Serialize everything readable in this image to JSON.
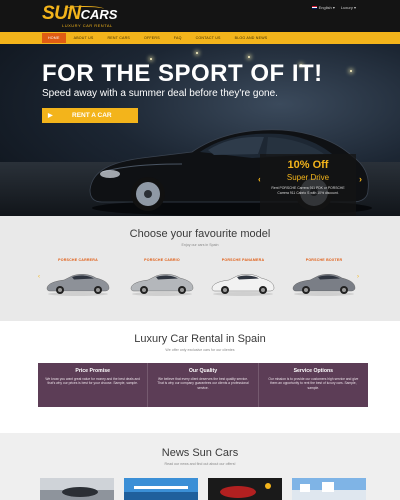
{
  "header": {
    "logo_main": "SUN",
    "logo_cars": "CARS",
    "logo_tagline": "LUXURY CAR RENTAL",
    "language": "English",
    "account": "Luxury"
  },
  "nav": {
    "items": [
      "HOME",
      "ABOUT US",
      "RENT CARS",
      "OFFERS",
      "FAQ",
      "CONTACT US",
      "BLOG AND NEWS"
    ],
    "active": "HOME"
  },
  "hero": {
    "title": "FOR THE SPORT OF IT!",
    "subtitle": "Speed away with a summer deal before they're gone.",
    "button": "RENT A CAR",
    "prev_arrow": "‹",
    "next_arrow": "›",
    "offer": {
      "percent": "10% Off",
      "name": "Super Drive",
      "description": "Rent PORSCHE Carrera 911 PDK or PORSCHE Carrera 911 Cabrio S with 10% discount."
    }
  },
  "models": {
    "title": "Choose your favourite model",
    "subtitle": "Enjoy our cars in Spain",
    "items": [
      "PORSCHE CARRERA",
      "PORSCHE CABRIO",
      "PORSCHE PANAMERA",
      "PORSCHE BOXTER"
    ],
    "car_colors": [
      "#8d9198",
      "#b4b7bb",
      "#f2f2f2",
      "#7a7e86"
    ]
  },
  "luxury": {
    "title": "Luxury Car Rental in Spain",
    "subtitle": "We offer only exclusive cars for our clientes",
    "features": [
      {
        "title": "Price Promise",
        "text": "We know you want great value for money and the best deals and that's why our prices is best for your choose. Sample, sample."
      },
      {
        "title": "Our Quality",
        "text": "We believe that every client deserves the best quality service. That is why our company guarantees our clients a professional service."
      },
      {
        "title": "Service Options",
        "text": "Our mission is to provide our customers high service and give them an opportunity to rent the best of luxury cars. Sample, sample."
      }
    ]
  },
  "news": {
    "title": "News Sun Cars",
    "subtitle": "Read our news and find out about our offers!"
  },
  "colors": {
    "accent": "#f3b41b",
    "nav_active": "#e05c13",
    "feature_bg": "#5c3d56",
    "header_bg": "#141414"
  }
}
